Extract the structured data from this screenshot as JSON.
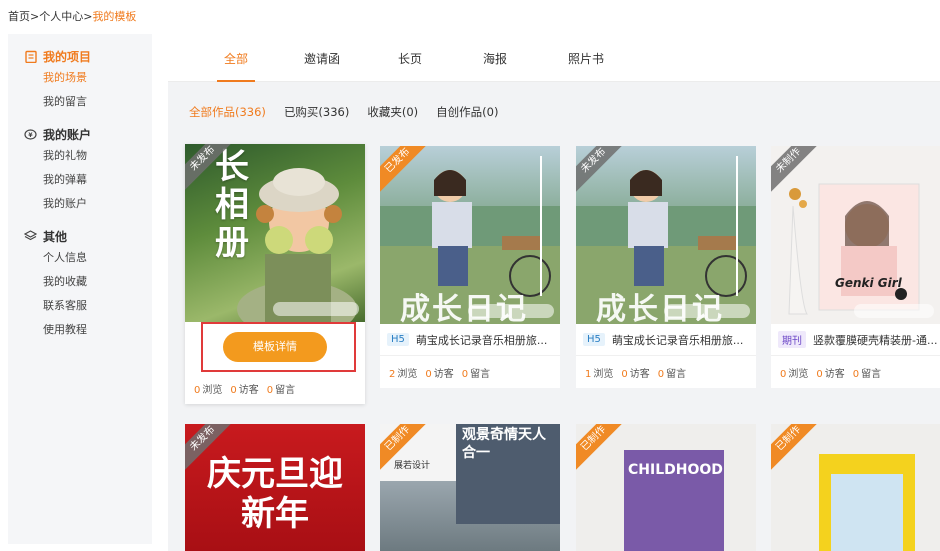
{
  "breadcrumb": {
    "home": "首页",
    "sep1": ">",
    "center": "个人中心",
    "sep2": ">",
    "current": "我的模板"
  },
  "sidebar": {
    "groups": [
      {
        "title": "我的项目",
        "items": [
          "我的场景",
          "我的留言"
        ]
      },
      {
        "title": "我的账户",
        "items": [
          "我的礼物",
          "我的弹幕",
          "我的账户"
        ]
      },
      {
        "title": "其他",
        "items": [
          "个人信息",
          "我的收藏",
          "联系客服",
          "使用教程"
        ]
      }
    ]
  },
  "tabs": [
    "全部",
    "邀请函",
    "长页",
    "海报",
    "照片书"
  ],
  "filters": [
    "全部作品(336)",
    "已购买(336)",
    "收藏夹(0)",
    "自创作品(0)"
  ],
  "stats_labels": {
    "views": "浏览",
    "visitors": "访客",
    "messages": "留言"
  },
  "cards": [
    {
      "ribbon": "未发布",
      "title_art": [
        "长",
        "相",
        "册"
      ],
      "button": "模板详情",
      "views": "0",
      "visitors": "0",
      "messages": "0"
    },
    {
      "ribbon": "已发布",
      "tag": "H5",
      "title": "萌宝成长记录音乐相册旅...",
      "overlay": "成长日记",
      "views": "2",
      "visitors": "0",
      "messages": "0"
    },
    {
      "ribbon": "未发布",
      "tag": "H5",
      "title": "萌宝成长记录音乐相册旅...",
      "overlay": "成长日记",
      "views": "1",
      "visitors": "0",
      "messages": "0"
    },
    {
      "ribbon": "未制作",
      "tag": "期刊",
      "title": "竖款覆膜硬壳精装册-通...",
      "overlay": "Genki Girl",
      "views": "0",
      "visitors": "0",
      "messages": "0"
    }
  ],
  "row2": [
    {
      "ribbon": "未发布",
      "overlay": "庆元旦迎新年"
    },
    {
      "ribbon": "已制作",
      "overlay": "观景奇情天人合一",
      "sub": "展若设计"
    },
    {
      "ribbon": "已制作",
      "overlay": "CHILDHOOD"
    },
    {
      "ribbon": "已制作"
    }
  ]
}
